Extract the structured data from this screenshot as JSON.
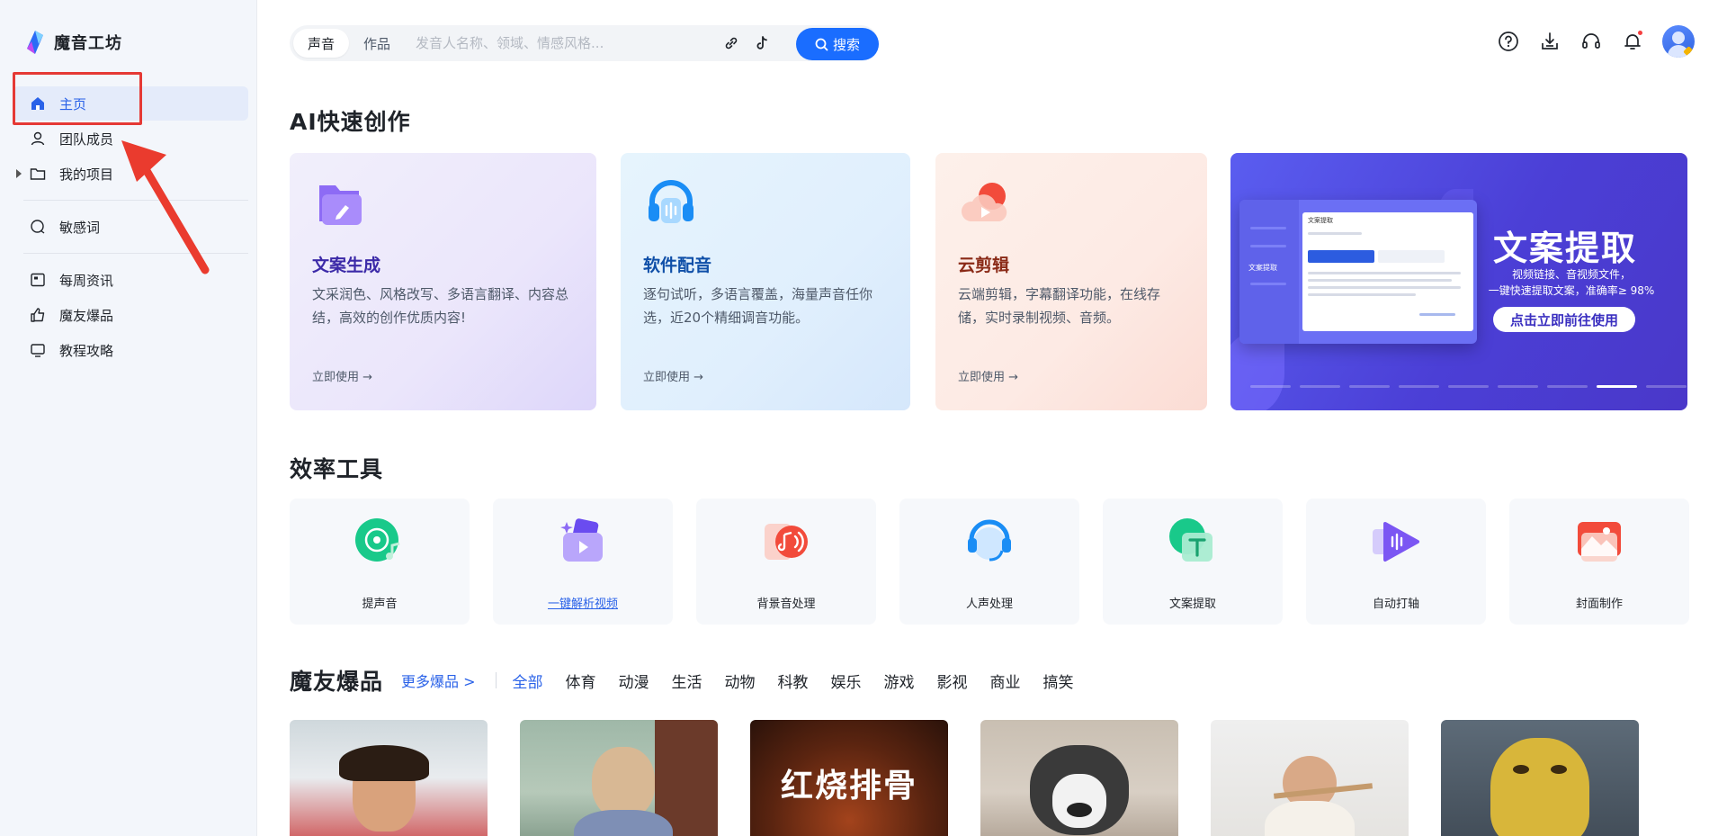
{
  "app": {
    "name": "魔音工坊"
  },
  "sidebar": {
    "items": [
      {
        "label": "主页",
        "icon": "home-icon",
        "active": true
      },
      {
        "label": "团队成员",
        "icon": "user-icon"
      },
      {
        "label": "我的项目",
        "icon": "folder-icon"
      },
      {
        "label": "敏感词",
        "icon": "sensitive-word-icon"
      },
      {
        "label": "每周资讯",
        "icon": "calendar-icon"
      },
      {
        "label": "魔友爆品",
        "icon": "thumbs-up-icon"
      },
      {
        "label": "教程攻略",
        "icon": "monitor-icon"
      }
    ]
  },
  "search": {
    "tabs": [
      "声音",
      "作品"
    ],
    "active_tab": "声音",
    "placeholder": "发音人名称、领域、情感风格...",
    "button_label": "搜索"
  },
  "header_icons": [
    "help-icon",
    "download-icon",
    "headset-icon",
    "bell-icon",
    "avatar"
  ],
  "ai_section": {
    "title": "AI快速创作",
    "cards": [
      {
        "title": "文案生成",
        "desc": "文采润色、风格改写、多语言翻译、内容总结，高效的创作优质内容!",
        "link": "立即使用 →"
      },
      {
        "title": "软件配音",
        "desc": "逐句试听，多语言覆盖，海量声音任你选，近20个精细调音功能。",
        "link": "立即使用 →"
      },
      {
        "title": "云剪辑",
        "desc": "云端剪辑，字幕翻译功能，在线存储，实时录制视频、音频。",
        "link": "立即使用 →"
      }
    ],
    "banner": {
      "title": "文案提取",
      "subtitle_line1": "视频链接、音视频文件，",
      "subtitle_line2": "一键快速提取文案，准确率≥ 98%",
      "button": "点击立即前往使用",
      "mock_header": "文案提取",
      "mock_side_item": "文案提取"
    }
  },
  "tools": {
    "title": "效率工具",
    "items": [
      {
        "label": "提声音"
      },
      {
        "label": "一键解析视频"
      },
      {
        "label": "背景音处理"
      },
      {
        "label": "人声处理"
      },
      {
        "label": "文案提取"
      },
      {
        "label": "自动打轴"
      },
      {
        "label": "封面制作"
      }
    ]
  },
  "hot": {
    "title": "魔友爆品",
    "more": "更多爆品 >",
    "categories": [
      "全部",
      "体育",
      "动漫",
      "生活",
      "动物",
      "科教",
      "娱乐",
      "游戏",
      "影视",
      "商业",
      "搞笑"
    ],
    "active_category": "全部",
    "thumb_texts": [
      "红烧排骨"
    ]
  },
  "colors": {
    "accent": "#1a6dff",
    "highlight": "#e53935"
  }
}
